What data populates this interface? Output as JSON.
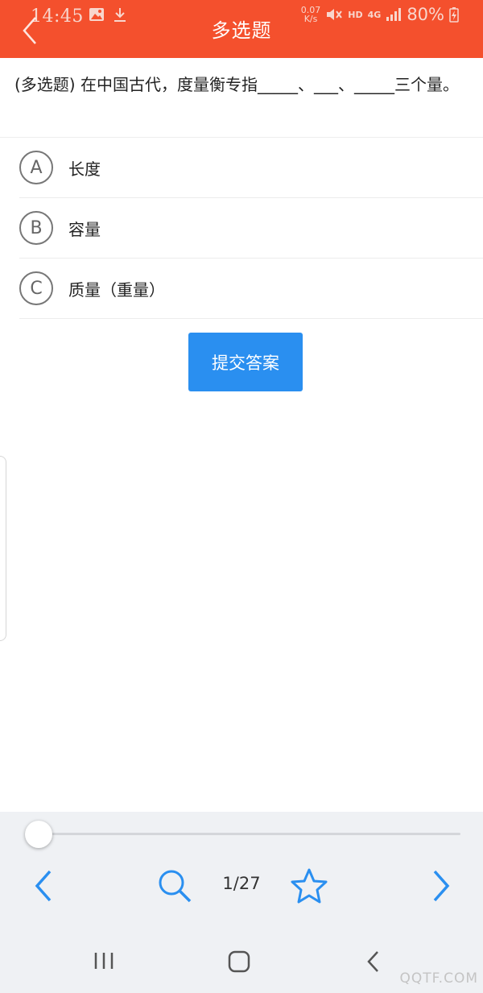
{
  "status": {
    "time": "14:45",
    "net_speed": "0.07",
    "net_unit": "K/s",
    "hd": "HD",
    "network": "4G",
    "battery": "80%"
  },
  "header": {
    "title": "多选题"
  },
  "question": {
    "text": "(多选题) 在中国古代，度量衡专指_____、___、_____三个量。"
  },
  "options": [
    {
      "letter": "A",
      "text": "长度"
    },
    {
      "letter": "B",
      "text": "容量"
    },
    {
      "letter": "C",
      "text": "质量（重量）"
    }
  ],
  "submit": {
    "label": "提交答案"
  },
  "progress": {
    "current": 1,
    "total": 27,
    "label": "1/27",
    "fraction": 0.0
  },
  "colors": {
    "header": "#f4502d",
    "accent": "#2a8ff0"
  },
  "watermark": "QQTF.COM"
}
